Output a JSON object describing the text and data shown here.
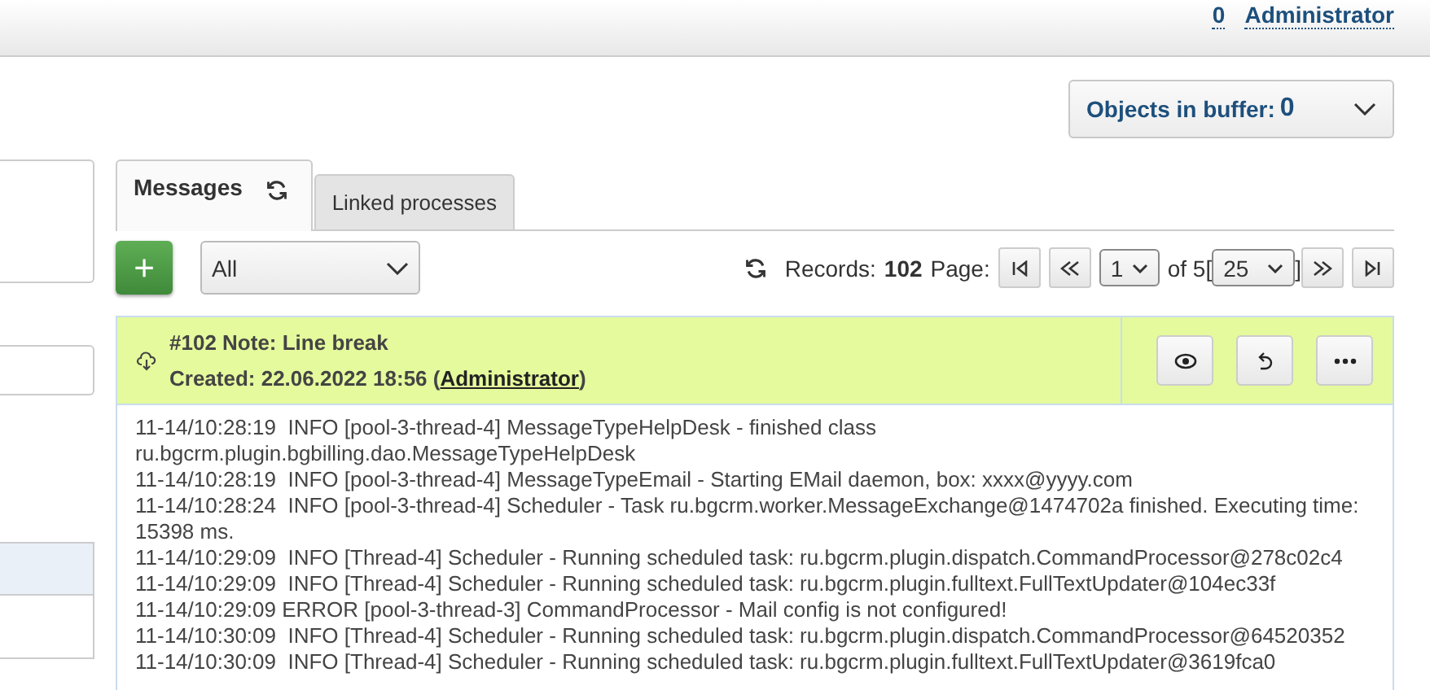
{
  "header": {
    "counter": "0",
    "user": "Administrator"
  },
  "buffer": {
    "label": "Objects in buffer: ",
    "count": "0"
  },
  "left_panel": {
    "list_items": [
      {
        "selected": true
      },
      {
        "selected": false
      }
    ]
  },
  "tabs": [
    {
      "label": "Messages",
      "selected": true,
      "refresh": true
    },
    {
      "label": "Linked processes",
      "selected": false,
      "refresh": false
    }
  ],
  "toolbar": {
    "add": "+",
    "filter": "All",
    "records_label": "Records:",
    "records": "102",
    "page_label": "Page:",
    "page": "1",
    "of": "of 5",
    "bracket_open": "[",
    "page_size": "25",
    "bracket_close": "]"
  },
  "message": {
    "title": "#102 Note: Line break",
    "created": "Created: 22.06.2022 18:56 (",
    "author": "Administrator",
    "created_end": ")"
  },
  "log": [
    "11-14/10:28:19  INFO [pool-3-thread-4] MessageTypeHelpDesk - finished class ru.bgcrm.plugin.bgbilling.dao.MessageTypeHelpDesk",
    "11-14/10:28:19  INFO [pool-3-thread-4] MessageTypeEmail - Starting EMail daemon, box: xxxx@yyyy.com",
    "11-14/10:28:24  INFO [pool-3-thread-4] Scheduler - Task ru.bgcrm.worker.MessageExchange@1474702a finished. Executing time: 15398 ms.",
    "11-14/10:29:09  INFO [Thread-4] Scheduler - Running scheduled task: ru.bgcrm.plugin.dispatch.CommandProcessor@278c02c4",
    "11-14/10:29:09  INFO [Thread-4] Scheduler - Running scheduled task: ru.bgcrm.plugin.fulltext.FullTextUpdater@104ec33f",
    "11-14/10:29:09 ERROR [pool-3-thread-3] CommandProcessor - Mail config is not configured!",
    "11-14/10:30:09  INFO [Thread-4] Scheduler - Running scheduled task: ru.bgcrm.plugin.dispatch.CommandProcessor@64520352",
    "11-14/10:30:09  INFO [Thread-4] Scheduler - Running scheduled task: ru.bgcrm.plugin.fulltext.FullTextUpdater@3619fca0"
  ]
}
